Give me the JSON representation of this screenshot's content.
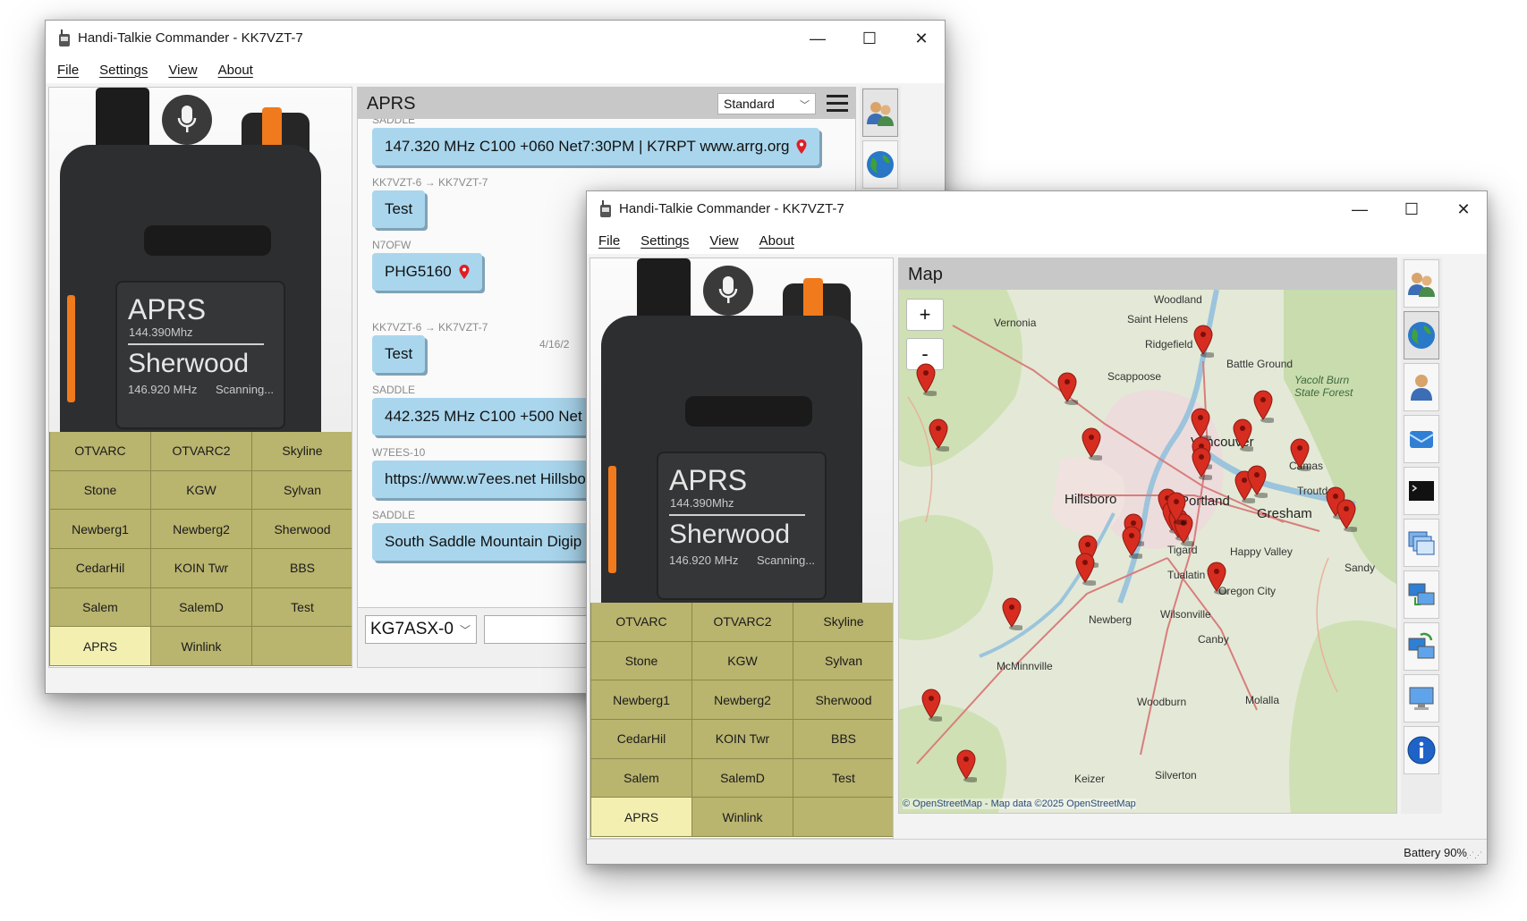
{
  "app": {
    "title": "Handi-Talkie Commander - KK7VZT-7",
    "menu": [
      "File",
      "Settings",
      "View",
      "About"
    ],
    "window_controls": [
      "minimize",
      "maximize",
      "close"
    ]
  },
  "radio": {
    "mode": "APRS",
    "mode_freq": "144.390Mhz",
    "channel": "Sherwood",
    "channel_freq": "146.920 MHz",
    "status": "Scanning...",
    "channels": [
      "OTVARC",
      "OTVARC2",
      "Skyline",
      "Stone",
      "KGW",
      "Sylvan",
      "Newberg1",
      "Newberg2",
      "Sherwood",
      "CedarHil",
      "KOIN Twr",
      "BBS",
      "Salem",
      "SalemD",
      "Test",
      "APRS",
      "Winlink",
      ""
    ],
    "active_channel": "APRS"
  },
  "aprs_window": {
    "panel_title": "APRS",
    "view_mode": "Standard",
    "messages": [
      {
        "from": "SADDLE",
        "text": "147.320 MHz C100 +060 Net7:30PM | K7RPT www.arrg.org",
        "has_location": true
      },
      {
        "from": "KK7VZT-6 → KK7VZT-7",
        "text": "Test",
        "has_location": false
      },
      {
        "from": "N7OFW",
        "text": "PHG5160",
        "has_location": true
      },
      {
        "from": "KK7VZT-6 → KK7VZT-7",
        "text": "Test",
        "has_location": false
      },
      {
        "from": "SADDLE",
        "text": "442.325 MHz C100 +500 Net",
        "has_location": false
      },
      {
        "from": "W7EES-10",
        "text": "https://www.w7ees.net Hillsbo",
        "has_location": false
      },
      {
        "from": "SADDLE",
        "text": "South Saddle Mountain Digip",
        "has_location": false
      }
    ],
    "timestamp": "4/16/2",
    "compose_callsign": "KG7ASX-0",
    "compose_text": ""
  },
  "map_window": {
    "panel_title": "Map",
    "zoom_in": "+",
    "zoom_out": "-",
    "attribution": "© OpenStreetMap - Map data ©2025 OpenStreetMap",
    "places": [
      "Woodland",
      "Vernonia",
      "Saint Helens",
      "Ridgefield",
      "Battle Ground",
      "Yacolt Burn State Forest",
      "Scappoose",
      "Vancouver",
      "Camas",
      "Hillsboro",
      "Portland",
      "Troutdale",
      "Gresham",
      "Happy Valley",
      "Tigard",
      "Tualatin",
      "Oregon City",
      "Sandy",
      "Newberg",
      "Wilsonville",
      "Canby",
      "McMinnville",
      "Woodburn",
      "Molalla",
      "Silverton",
      "Keizer"
    ],
    "station_count": 28,
    "status": "Battery 90%"
  },
  "sidebar_icons": {
    "aprs_window": [
      "contacts-icon",
      "globe-icon"
    ],
    "map_window": [
      "contacts-icon",
      "globe-icon",
      "user-icon",
      "mail-icon",
      "terminal-icon",
      "windows-icon",
      "network-icon",
      "network-sync-icon",
      "computer-icon",
      "info-icon"
    ]
  },
  "colors": {
    "channel_button": "#b9b46e",
    "channel_button_active": "#f3efb1",
    "message_bubble": "#a9d6ed",
    "map_marker": "#d62d20",
    "panel_header": "#c8c8c8"
  }
}
